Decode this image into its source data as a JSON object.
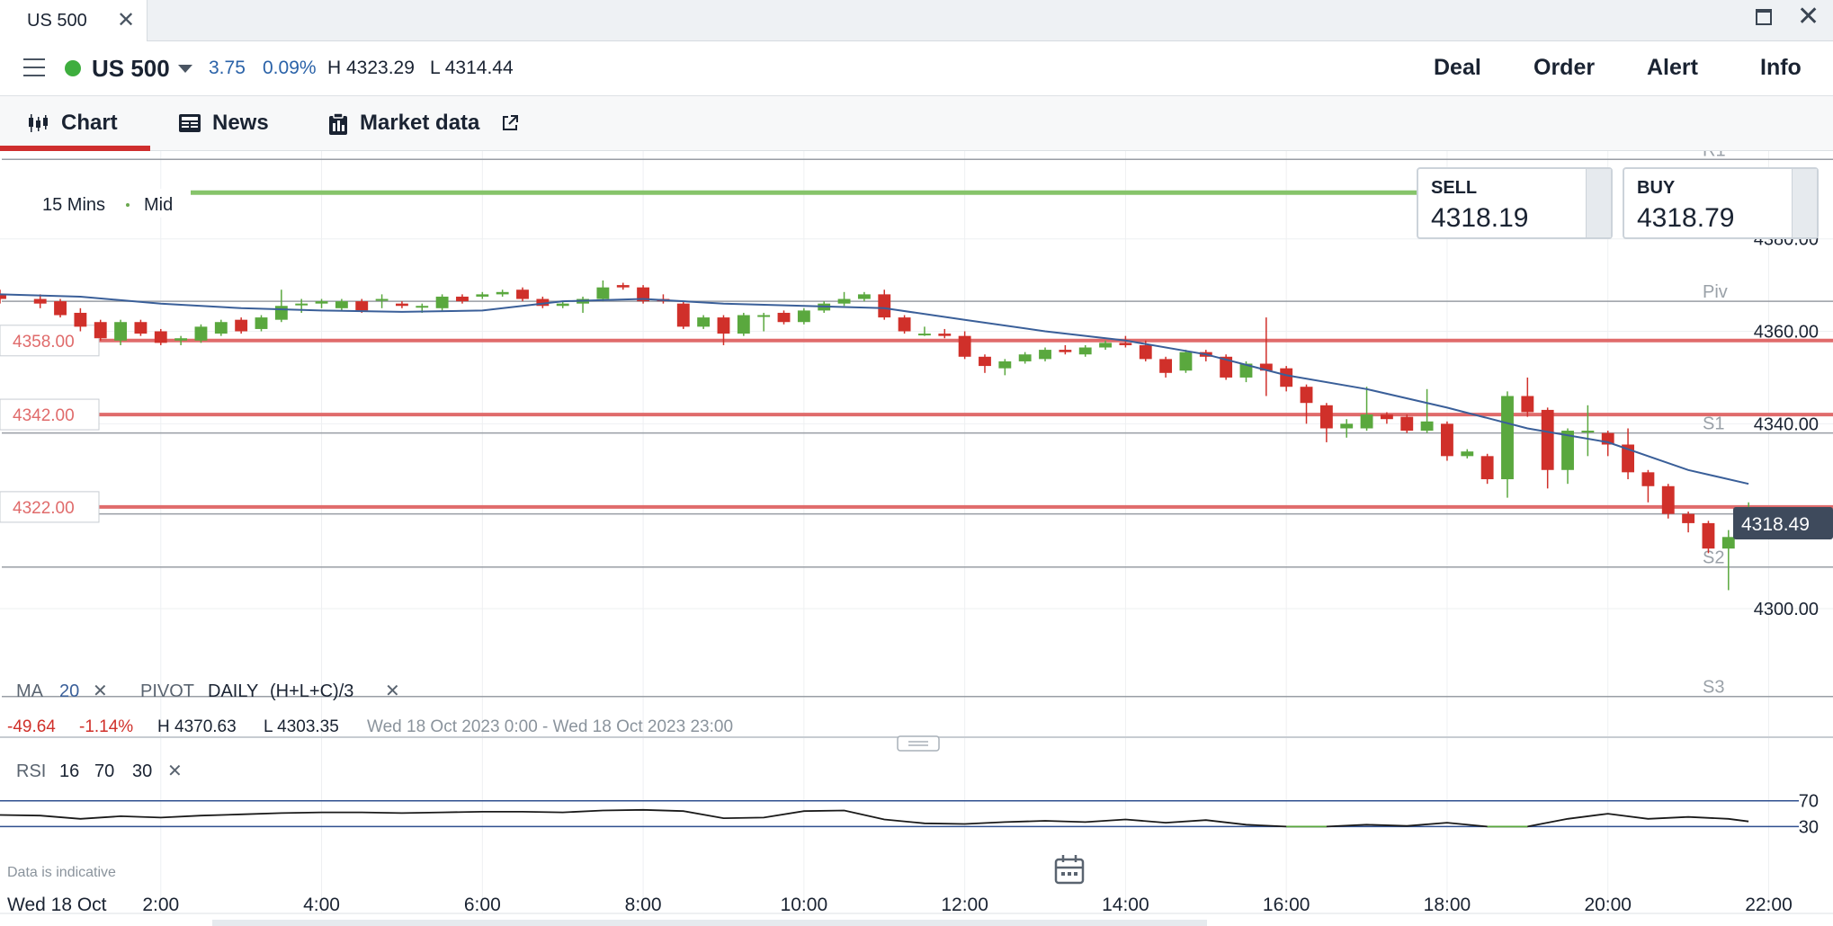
{
  "window": {
    "tab_title": "US 500",
    "close_glyph": "✕",
    "max_glyph": "",
    "win_close_glyph": "✕"
  },
  "instrument": {
    "name": "US 500",
    "status_color": "#3eae3e",
    "change_abs": "3.75",
    "change_pct": "0.09%",
    "high": "H 4323.29",
    "low": "L 4314.44"
  },
  "actions": {
    "deal": "Deal",
    "order": "Order",
    "alert": "Alert",
    "info": "Info"
  },
  "tabs": {
    "chart": "Chart",
    "news": "News",
    "market_data": "Market data"
  },
  "tickets": {
    "sell_label": "SELL",
    "sell_price": "4318.19",
    "buy_label": "BUY",
    "buy_price": "4318.79"
  },
  "chart_toolbar": {
    "interval": "15 Mins",
    "price_type": "Mid",
    "green_level_partial": "4"
  },
  "indicators": {
    "ma_label": "MA",
    "ma_period": "20",
    "pivot_label": "PIVOT",
    "pivot_period": "DAILY",
    "pivot_formula": "(H+L+C)/3",
    "rsi_label": "RSI",
    "rsi_period": "16",
    "rsi_upper": "70",
    "rsi_lower": "30",
    "remove_glyph": "✕"
  },
  "period_summary": {
    "change_abs": "-49.64",
    "change_pct": "-1.14%",
    "high": "H 4370.63",
    "low": "L 4303.35",
    "range": "Wed 18 Oct 2023 0:00 - Wed 18 Oct 2023 23:00"
  },
  "footer": {
    "disclaimer": "Data is indicative",
    "date_label": "Wed 18 Oct"
  },
  "colors": {
    "up": "#5aa83e",
    "down": "#d0302a",
    "ma_line": "#3a5f99",
    "alert_line": "#e06b6b",
    "pivot_line": "#999ea5",
    "current_price_bg": "#3e4a5c",
    "green_level": "#86c46a",
    "rsi_band": "#2f4f8f"
  },
  "chart_data": {
    "type": "candlestick",
    "interval_minutes": 15,
    "x_axis": {
      "ticks": [
        "2:00",
        "4:00",
        "6:00",
        "8:00",
        "10:00",
        "12:00",
        "14:00",
        "16:00",
        "18:00",
        "20:00",
        "22:00"
      ],
      "tick_hours": [
        2,
        4,
        6,
        8,
        10,
        12,
        14,
        16,
        18,
        20,
        22
      ],
      "range_hours": [
        0.0,
        22.8
      ]
    },
    "y_axis": {
      "ticks": [
        "4380.00",
        "4360.00",
        "4340.00",
        "4300.00"
      ],
      "tick_values": [
        4380,
        4360,
        4340,
        4300
      ],
      "range": [
        4293,
        4399
      ]
    },
    "current_price": "4318.49",
    "current_price_value": 4318.49,
    "pivot_levels": [
      {
        "name": "R1",
        "value": 4397.2
      },
      {
        "name": "Piv",
        "value": 4366.5
      },
      {
        "name": "S1",
        "value": 4338.0
      },
      {
        "name": "S2",
        "value": 4309.0
      },
      {
        "name": "S3",
        "value": 4281.0
      },
      {
        "name": "",
        "value": 4320.5
      }
    ],
    "alert_levels": [
      {
        "label": "4358.00",
        "value": 4358
      },
      {
        "label": "4342.00",
        "value": 4342
      },
      {
        "label": "4322.00",
        "value": 4322
      }
    ],
    "green_level_value": 4390,
    "candles": [
      {
        "h": 0.0,
        "o": 4368,
        "c": 4367,
        "hi": 4369,
        "lo": 4366
      },
      {
        "h": 0.5,
        "o": 4367,
        "c": 4366,
        "hi": 4368,
        "lo": 4365
      },
      {
        "h": 0.75,
        "o": 4366.5,
        "c": 4363.5,
        "hi": 4367,
        "lo": 4363
      },
      {
        "h": 1.0,
        "o": 4364,
        "c": 4361,
        "hi": 4365,
        "lo": 4360
      },
      {
        "h": 1.25,
        "o": 4362,
        "c": 4358.5,
        "hi": 4362.5,
        "lo": 4358
      },
      {
        "h": 1.5,
        "o": 4358,
        "c": 4362,
        "hi": 4362.5,
        "lo": 4357
      },
      {
        "h": 1.75,
        "o": 4362,
        "c": 4359.5,
        "hi": 4362.5,
        "lo": 4359
      },
      {
        "h": 2.0,
        "o": 4360,
        "c": 4357.5,
        "hi": 4360.5,
        "lo": 4357
      },
      {
        "h": 2.25,
        "o": 4358,
        "c": 4358.5,
        "hi": 4359,
        "lo": 4357
      },
      {
        "h": 2.5,
        "o": 4358,
        "c": 4361,
        "hi": 4361.5,
        "lo": 4357.5
      },
      {
        "h": 2.75,
        "o": 4359.5,
        "c": 4362,
        "hi": 4362.5,
        "lo": 4359
      },
      {
        "h": 3.0,
        "o": 4362.5,
        "c": 4360,
        "hi": 4363,
        "lo": 4359.5
      },
      {
        "h": 3.25,
        "o": 4360.5,
        "c": 4363,
        "hi": 4363.5,
        "lo": 4360
      },
      {
        "h": 3.5,
        "o": 4362.5,
        "c": 4365.5,
        "hi": 4369,
        "lo": 4362
      },
      {
        "h": 3.75,
        "o": 4366,
        "c": 4366,
        "hi": 4367,
        "lo": 4364
      },
      {
        "h": 4.0,
        "o": 4366,
        "c": 4366.5,
        "hi": 4367,
        "lo": 4365
      },
      {
        "h": 4.25,
        "o": 4365,
        "c": 4366.5,
        "hi": 4367,
        "lo": 4364.5
      },
      {
        "h": 4.5,
        "o": 4366.5,
        "c": 4364.5,
        "hi": 4367,
        "lo": 4364
      },
      {
        "h": 4.75,
        "o": 4367,
        "c": 4367,
        "hi": 4368,
        "lo": 4365
      },
      {
        "h": 5.0,
        "o": 4366,
        "c": 4365.5,
        "hi": 4366.5,
        "lo": 4365
      },
      {
        "h": 5.25,
        "o": 4365.5,
        "c": 4365.5,
        "hi": 4366,
        "lo": 4364
      },
      {
        "h": 5.5,
        "o": 4365,
        "c": 4367.5,
        "hi": 4368,
        "lo": 4364.5
      },
      {
        "h": 5.75,
        "o": 4367.5,
        "c": 4366.5,
        "hi": 4368,
        "lo": 4366
      },
      {
        "h": 6.0,
        "o": 4367.5,
        "c": 4368,
        "hi": 4368.5,
        "lo": 4367
      },
      {
        "h": 6.25,
        "o": 4368,
        "c": 4368.5,
        "hi": 4369,
        "lo": 4367.5
      },
      {
        "h": 6.5,
        "o": 4369,
        "c": 4367,
        "hi": 4369.5,
        "lo": 4366.5
      },
      {
        "h": 6.75,
        "o": 4367,
        "c": 4365.5,
        "hi": 4367.5,
        "lo": 4365
      },
      {
        "h": 7.0,
        "o": 4365.5,
        "c": 4366,
        "hi": 4366.5,
        "lo": 4365
      },
      {
        "h": 7.25,
        "o": 4366,
        "c": 4367,
        "hi": 4367.5,
        "lo": 4364
      },
      {
        "h": 7.5,
        "o": 4367,
        "c": 4369.5,
        "hi": 4371,
        "lo": 4366.5
      },
      {
        "h": 7.75,
        "o": 4370,
        "c": 4369.5,
        "hi": 4370.5,
        "lo": 4369
      },
      {
        "h": 8.0,
        "o": 4369.5,
        "c": 4366.5,
        "hi": 4370,
        "lo": 4366
      },
      {
        "h": 8.25,
        "o": 4367,
        "c": 4366.5,
        "hi": 4368,
        "lo": 4366
      },
      {
        "h": 8.5,
        "o": 4366,
        "c": 4361,
        "hi": 4366.5,
        "lo": 4360.5
      },
      {
        "h": 8.75,
        "o": 4361,
        "c": 4363,
        "hi": 4363.5,
        "lo": 4360.5
      },
      {
        "h": 9.0,
        "o": 4363,
        "c": 4359.5,
        "hi": 4363.5,
        "lo": 4357
      },
      {
        "h": 9.25,
        "o": 4359.5,
        "c": 4363.5,
        "hi": 4364,
        "lo": 4359
      },
      {
        "h": 9.5,
        "o": 4363.5,
        "c": 4363.5,
        "hi": 4364,
        "lo": 4360
      },
      {
        "h": 9.75,
        "o": 4364,
        "c": 4362,
        "hi": 4364.5,
        "lo": 4361.5
      },
      {
        "h": 10.0,
        "o": 4362,
        "c": 4364.5,
        "hi": 4365,
        "lo": 4361.5
      },
      {
        "h": 10.25,
        "o": 4364.5,
        "c": 4366,
        "hi": 4366.5,
        "lo": 4364
      },
      {
        "h": 10.5,
        "o": 4366,
        "c": 4367,
        "hi": 4368.5,
        "lo": 4365.5
      },
      {
        "h": 10.75,
        "o": 4367,
        "c": 4368,
        "hi": 4368.5,
        "lo": 4366.5
      },
      {
        "h": 11.0,
        "o": 4368,
        "c": 4363,
        "hi": 4369,
        "lo": 4362.5
      },
      {
        "h": 11.25,
        "o": 4363,
        "c": 4360,
        "hi": 4363.5,
        "lo": 4359.5
      },
      {
        "h": 11.5,
        "o": 4359.5,
        "c": 4359.5,
        "hi": 4361,
        "lo": 4359
      },
      {
        "h": 11.75,
        "o": 4359.5,
        "c": 4359,
        "hi": 4360.5,
        "lo": 4358.5
      },
      {
        "h": 12.0,
        "o": 4359,
        "c": 4354.5,
        "hi": 4360,
        "lo": 4354
      },
      {
        "h": 12.25,
        "o": 4354.5,
        "c": 4352.5,
        "hi": 4355,
        "lo": 4351
      },
      {
        "h": 12.5,
        "o": 4352,
        "c": 4353.5,
        "hi": 4354,
        "lo": 4350.5
      },
      {
        "h": 12.75,
        "o": 4353.5,
        "c": 4355,
        "hi": 4355.5,
        "lo": 4353
      },
      {
        "h": 13.0,
        "o": 4354,
        "c": 4356,
        "hi": 4356.5,
        "lo": 4353.5
      },
      {
        "h": 13.25,
        "o": 4356,
        "c": 4355.5,
        "hi": 4357,
        "lo": 4355
      },
      {
        "h": 13.5,
        "o": 4355,
        "c": 4356.5,
        "hi": 4357,
        "lo": 4354.5
      },
      {
        "h": 13.75,
        "o": 4356.5,
        "c": 4357.5,
        "hi": 4358,
        "lo": 4356
      },
      {
        "h": 14.0,
        "o": 4357.5,
        "c": 4357,
        "hi": 4359,
        "lo": 4356.5
      },
      {
        "h": 14.25,
        "o": 4357,
        "c": 4354,
        "hi": 4358,
        "lo": 4353.5
      },
      {
        "h": 14.5,
        "o": 4354,
        "c": 4351,
        "hi": 4354.5,
        "lo": 4350
      },
      {
        "h": 14.75,
        "o": 4351.5,
        "c": 4355.5,
        "hi": 4356,
        "lo": 4351
      },
      {
        "h": 15.0,
        "o": 4355.5,
        "c": 4354.5,
        "hi": 4356,
        "lo": 4353.5
      },
      {
        "h": 15.25,
        "o": 4354.5,
        "c": 4350,
        "hi": 4355,
        "lo": 4349.5
      },
      {
        "h": 15.5,
        "o": 4350,
        "c": 4353,
        "hi": 4353.5,
        "lo": 4349
      },
      {
        "h": 15.75,
        "o": 4353,
        "c": 4351.5,
        "hi": 4363,
        "lo": 4346
      },
      {
        "h": 16.0,
        "o": 4352,
        "c": 4348,
        "hi": 4352.5,
        "lo": 4347
      },
      {
        "h": 16.25,
        "o": 4348,
        "c": 4344.5,
        "hi": 4348.5,
        "lo": 4340
      },
      {
        "h": 16.5,
        "o": 4344,
        "c": 4339,
        "hi": 4344.5,
        "lo": 4336
      },
      {
        "h": 16.75,
        "o": 4339,
        "c": 4340,
        "hi": 4341,
        "lo": 4337
      },
      {
        "h": 17.0,
        "o": 4339,
        "c": 4342,
        "hi": 4348,
        "lo": 4338.5
      },
      {
        "h": 17.25,
        "o": 4342,
        "c": 4341,
        "hi": 4342.5,
        "lo": 4340
      },
      {
        "h": 17.5,
        "o": 4341.5,
        "c": 4338.5,
        "hi": 4342,
        "lo": 4338
      },
      {
        "h": 17.75,
        "o": 4338.5,
        "c": 4340.5,
        "hi": 4347.5,
        "lo": 4338
      },
      {
        "h": 18.0,
        "o": 4340,
        "c": 4333,
        "hi": 4340.5,
        "lo": 4332
      },
      {
        "h": 18.25,
        "o": 4333,
        "c": 4334,
        "hi": 4334.5,
        "lo": 4332.5
      },
      {
        "h": 18.5,
        "o": 4333,
        "c": 4328,
        "hi": 4333.5,
        "lo": 4327
      },
      {
        "h": 18.75,
        "o": 4328,
        "c": 4346,
        "hi": 4347,
        "lo": 4324
      },
      {
        "h": 19.0,
        "o": 4346,
        "c": 4342.5,
        "hi": 4350,
        "lo": 4341.5
      },
      {
        "h": 19.25,
        "o": 4343,
        "c": 4330,
        "hi": 4343.5,
        "lo": 4326
      },
      {
        "h": 19.5,
        "o": 4330,
        "c": 4338.5,
        "hi": 4339,
        "lo": 4327
      },
      {
        "h": 19.75,
        "o": 4338.5,
        "c": 4338.5,
        "hi": 4344,
        "lo": 4333
      },
      {
        "h": 20.0,
        "o": 4338,
        "c": 4335.5,
        "hi": 4338.5,
        "lo": 4333
      },
      {
        "h": 20.25,
        "o": 4335.5,
        "c": 4329.5,
        "hi": 4339,
        "lo": 4328
      },
      {
        "h": 20.5,
        "o": 4329.5,
        "c": 4326.5,
        "hi": 4330,
        "lo": 4323
      },
      {
        "h": 20.75,
        "o": 4326.5,
        "c": 4320.5,
        "hi": 4327,
        "lo": 4319.5
      },
      {
        "h": 21.0,
        "o": 4320.5,
        "c": 4318.5,
        "hi": 4321,
        "lo": 4316.5
      },
      {
        "h": 21.25,
        "o": 4318.5,
        "c": 4313,
        "hi": 4319,
        "lo": 4312
      },
      {
        "h": 21.5,
        "o": 4313,
        "c": 4315.5,
        "hi": 4317,
        "lo": 4304
      },
      {
        "h": 21.75,
        "o": 4315.5,
        "c": 4319,
        "hi": 4323,
        "lo": 4315
      }
    ],
    "ma20": {
      "h": [
        0.0,
        1.0,
        2.0,
        3.0,
        4.0,
        5.0,
        6.0,
        7.0,
        8.0,
        9.0,
        10.0,
        11.0,
        12.0,
        13.0,
        14.0,
        15.0,
        16.0,
        17.0,
        18.0,
        19.0,
        20.0,
        21.0,
        21.75
      ],
      "v": [
        4368,
        4367.5,
        4366,
        4365,
        4364.5,
        4364.2,
        4364.5,
        4366.5,
        4367,
        4366,
        4365.5,
        4365,
        4362.5,
        4360,
        4358,
        4355,
        4350.5,
        4347.5,
        4343.5,
        4339,
        4336,
        4330,
        4327
      ]
    },
    "rsi": {
      "axis_ticks": [
        "70",
        "30"
      ],
      "range": [
        18,
        85
      ],
      "h": [
        0.0,
        0.5,
        1.0,
        1.5,
        2.0,
        2.5,
        3.0,
        3.5,
        4.0,
        4.5,
        5.0,
        5.5,
        6.0,
        6.5,
        7.0,
        7.5,
        8.0,
        8.5,
        9.0,
        9.5,
        10.0,
        10.5,
        11.0,
        11.5,
        12.0,
        12.5,
        13.0,
        13.5,
        14.0,
        14.5,
        15.0,
        15.5,
        16.0,
        16.5,
        17.0,
        17.5,
        18.0,
        18.5,
        19.0,
        19.5,
        20.0,
        20.5,
        21.0,
        21.5,
        21.75
      ],
      "v": [
        48,
        47,
        42,
        46,
        44,
        47,
        49,
        51,
        52,
        52,
        51,
        52,
        53,
        53,
        52,
        55,
        56,
        54,
        43,
        44,
        54,
        55,
        41,
        35,
        34,
        37,
        39,
        37,
        41,
        36,
        40,
        33,
        30,
        30,
        33,
        31,
        36,
        30,
        30,
        42,
        50,
        42,
        45,
        42,
        38
      ]
    }
  }
}
